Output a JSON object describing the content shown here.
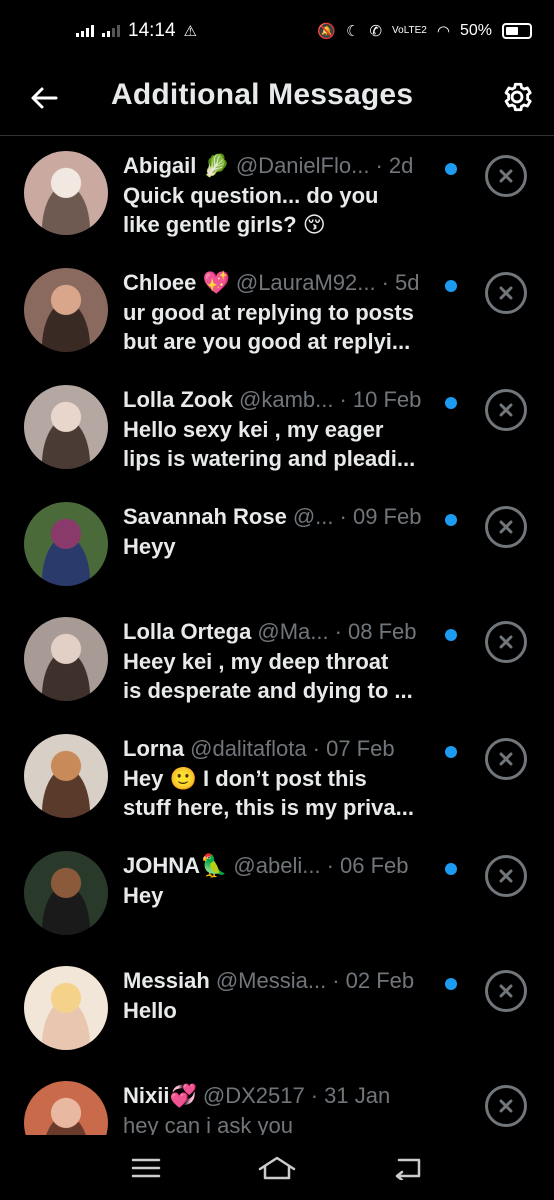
{
  "status_bar": {
    "time": "14:14",
    "battery": "50%",
    "volte": "VoLTE2"
  },
  "header": {
    "title": "Additional Messages"
  },
  "messages": [
    {
      "name": "Abigail 🥬",
      "handle": "@DanielFlo...",
      "time": "· 2d",
      "preview1": "Quick question... do you",
      "preview2": "like gentle girls? 😚",
      "unread": true,
      "avatar_colors": [
        "#c9a9a0",
        "#f2e8e2",
        "#6f5a52"
      ]
    },
    {
      "name": "Chloee 💖",
      "handle": "@LauraM92...",
      "time": "· 5d",
      "preview1": "ur good at replying to posts",
      "preview2": "but are you good at replyi...",
      "unread": true,
      "avatar_colors": [
        "#8a6a5e",
        "#d9a68c",
        "#3a2a24"
      ]
    },
    {
      "name": "Lolla Zook",
      "handle": "@kamb...",
      "time": "· 10 Feb",
      "preview1": "Hello sexy kei  , my eager",
      "preview2": "lips is watering and pleadi...",
      "unread": true,
      "avatar_colors": [
        "#b5a8a2",
        "#e8d6cc",
        "#4a3b35"
      ]
    },
    {
      "name": "Savannah Rose",
      "handle": "@...",
      "time": "· 09 Feb",
      "preview1": "Heyy",
      "preview2": "",
      "unread": true,
      "avatar_colors": [
        "#4a6a3a",
        "#8a3a6a",
        "#2a3a6a"
      ]
    },
    {
      "name": "Lolla Ortega",
      "handle": "@Ma...",
      "time": "· 08 Feb",
      "preview1": "Heey kei  , my deep throat",
      "preview2": "is desperate and dying to ...",
      "unread": true,
      "avatar_colors": [
        "#a89a94",
        "#e2d0c6",
        "#3e302a"
      ]
    },
    {
      "name": "Lorna",
      "handle": "@dalitaflota",
      "time": "· 07 Feb",
      "preview1": "Hey 🙂 I don’t post this",
      "preview2": "stuff here, this is my priva...",
      "unread": true,
      "avatar_colors": [
        "#d8cfc7",
        "#c98a5a",
        "#5a3a2a"
      ]
    },
    {
      "name": "JOHNA🦜",
      "handle": "@abeli...",
      "time": "· 06 Feb",
      "preview1": "Hey",
      "preview2": "",
      "unread": true,
      "avatar_colors": [
        "#2a3a2a",
        "#8a5a3a",
        "#1a1a1a"
      ]
    },
    {
      "name": "Messiah",
      "handle": "@Messia...",
      "time": "· 02 Feb",
      "preview1": "Hello",
      "preview2": "",
      "unread": true,
      "avatar_colors": [
        "#f2e6d8",
        "#f5d28a",
        "#e8c6b0"
      ]
    },
    {
      "name": "Nixii💞",
      "handle": "@DX2517",
      "time": "· 31 Jan",
      "preview1": "hey can i ask you",
      "preview2": "",
      "unread": false,
      "avatar_colors": [
        "#c96a4a",
        "#e8b8a0",
        "#6a3a2a"
      ]
    }
  ],
  "icons": {
    "back": "arrow-left-icon",
    "settings": "gear-icon",
    "dismiss": "close-circle-icon",
    "nav_menu": "menu-icon",
    "nav_home": "home-icon",
    "nav_back": "back-icon"
  },
  "colors": {
    "background": "#000000",
    "text": "#e7e9ea",
    "muted": "#71767b",
    "accent": "#1d9bf0",
    "divider": "#2f3336"
  }
}
